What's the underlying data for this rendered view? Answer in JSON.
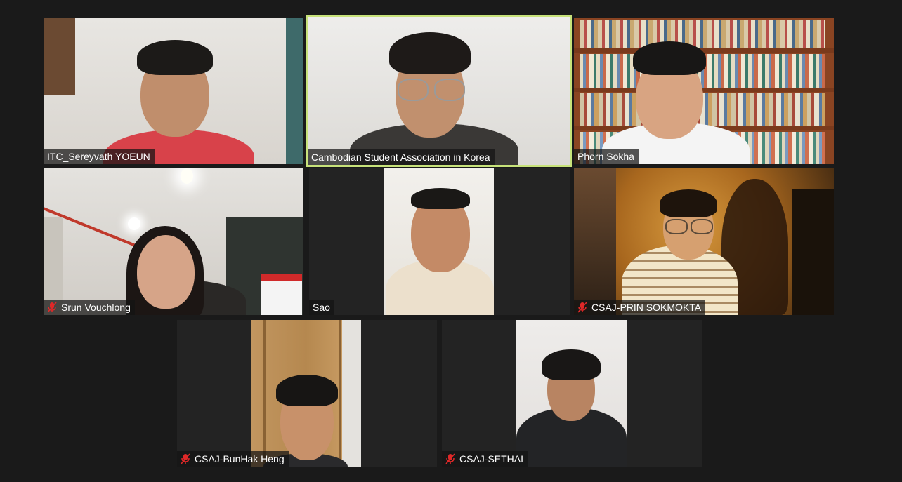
{
  "participants": [
    {
      "name": "ITC_Sereyvath YOEUN",
      "muted": false,
      "active": false
    },
    {
      "name": "Cambodian Student Association in Korea",
      "muted": false,
      "active": true
    },
    {
      "name": "Phorn Sokha",
      "muted": false,
      "active": false
    },
    {
      "name": "Srun Vouchlong",
      "muted": true,
      "active": false
    },
    {
      "name": "Sao",
      "muted": false,
      "active": false
    },
    {
      "name": "CSAJ-PRIN SOKMOKTA",
      "muted": true,
      "active": false
    },
    {
      "name": "CSAJ-BunHak Heng",
      "muted": true,
      "active": false
    },
    {
      "name": "CSAJ-SETHAI",
      "muted": true,
      "active": false
    }
  ],
  "icons": {
    "muted": "mic-muted-icon"
  },
  "colors": {
    "background": "#1a1a1a",
    "tile": "#232323",
    "active_speaker_border": "#c7e27a",
    "muted_icon": "#e02828"
  }
}
